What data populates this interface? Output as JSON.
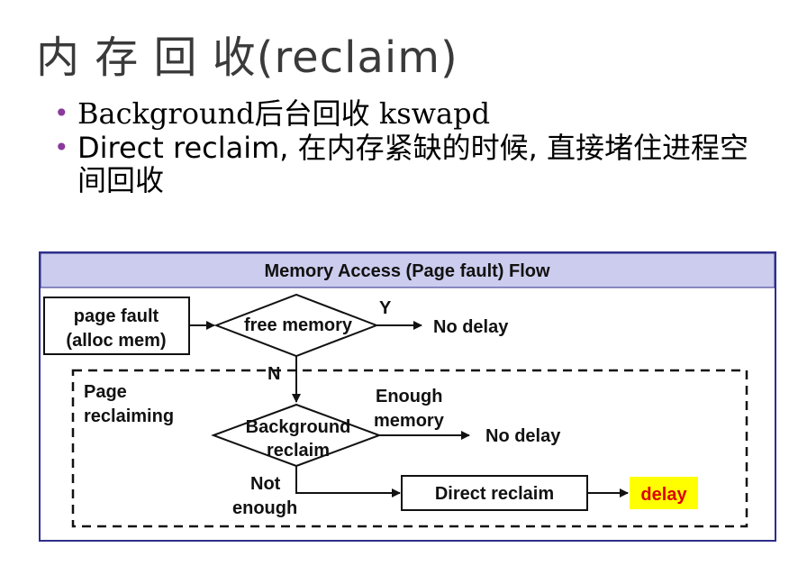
{
  "title": "内 存 回 收(reclaim)",
  "bullets": [
    "Background后台回收 kswapd",
    "Direct reclaim, 在内存紧缺的时候, 直接堵住进程空间回收"
  ],
  "diagram": {
    "header": "Memory Access (Page fault) Flow",
    "nodes": {
      "page_fault_line1": "page fault",
      "page_fault_line2": "(alloc mem)",
      "free_memory": "free memory",
      "yes_label": "Y",
      "no_delay_1": "No delay",
      "no_label": "N",
      "page_reclaiming_line1": "Page",
      "page_reclaiming_line2": "reclaiming",
      "background_line1": "Background",
      "background_line2": "reclaim",
      "enough_line1": "Enough",
      "enough_line2": "memory",
      "no_delay_2": "No delay",
      "not_enough_line1": "Not",
      "not_enough_line2": "enough",
      "direct_reclaim": "Direct reclaim",
      "delay": "delay"
    },
    "colors": {
      "header_bg": "#ccccee",
      "frame_border": "#2e2e8a",
      "delay_bg": "#ffff00",
      "delay_text": "#dd0000",
      "bullet_dot": "#8a3a9a"
    }
  }
}
